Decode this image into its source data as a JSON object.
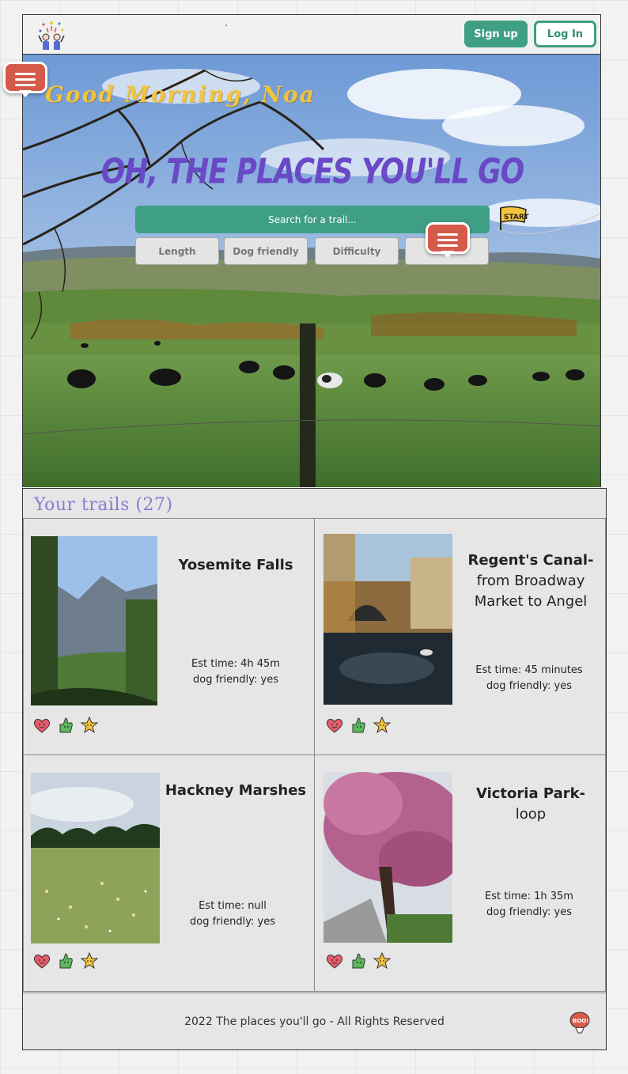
{
  "header": {
    "signup_label": "Sign up",
    "login_label": "Log In",
    "logo_icon": "confetti-people-logo-icon"
  },
  "hero": {
    "greeting": "Good Morning, Noa",
    "headline": "OH, THE PLACES YOU'LL GO",
    "search_placeholder": "Search for a trail...",
    "flag_label": "START",
    "filters": [
      "Length",
      "Dog friendly",
      "Difficulty",
      ""
    ]
  },
  "trails": {
    "title": "Your trails (27)",
    "items": [
      {
        "name_bold": "Yosemite Falls",
        "name_rest": "",
        "est_time": "Est time: 4h 45m",
        "dog": "dog friendly: yes"
      },
      {
        "name_bold": "Regent's Canal-",
        "name_rest": "from Broadway Market to Angel",
        "est_time": "Est time: 45 minutes",
        "dog": "dog friendly: yes"
      },
      {
        "name_bold": "Hackney Marshes",
        "name_rest": "",
        "est_time": "Est time: null",
        "dog": "dog friendly: yes"
      },
      {
        "name_bold": "Victoria Park-",
        "name_rest": "loop",
        "est_time": "Est time: 1h 35m",
        "dog": "dog friendly: yes"
      }
    ],
    "reaction_icons": [
      "heart-face-icon",
      "thumbs-up-icon",
      "star-face-icon"
    ]
  },
  "footer": {
    "text": "2022 The places you'll go - All Rights Reserved",
    "badge_label": "BOO!"
  },
  "colors": {
    "accent_green": "#3f9f85",
    "headline_purple": "#6a49c7",
    "greeting_yellow": "#f3c33b",
    "comment_red": "#d55a4a"
  }
}
